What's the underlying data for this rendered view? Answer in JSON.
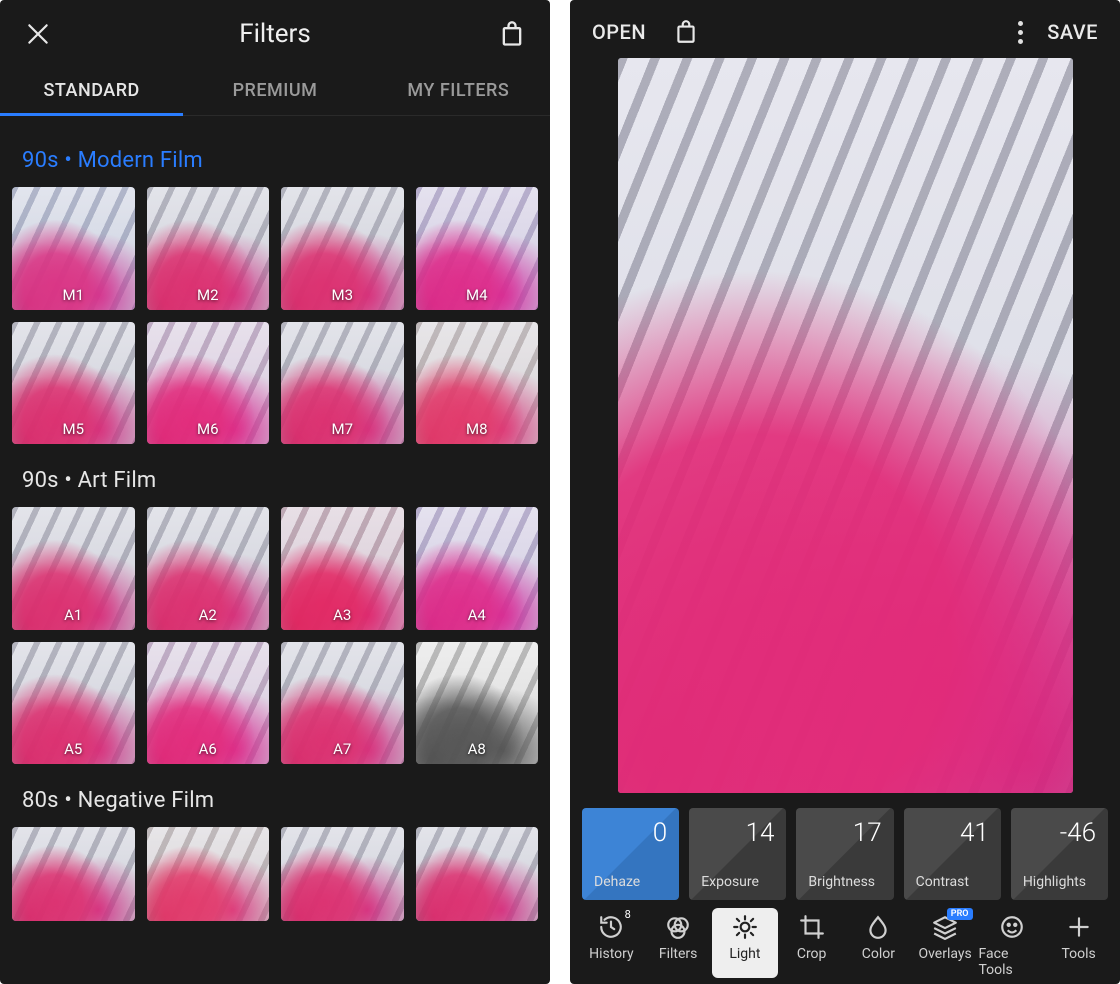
{
  "left": {
    "title": "Filters",
    "tabs": [
      {
        "label": "STANDARD",
        "active": true
      },
      {
        "label": "PREMIUM",
        "active": false
      },
      {
        "label": "MY FILTERS",
        "active": false
      }
    ],
    "sections": [
      {
        "title": "90s • Modern Film",
        "accent": true,
        "filters": [
          "M1",
          "M2",
          "M3",
          "M4",
          "M5",
          "M6",
          "M7",
          "M8"
        ],
        "tints": [
          "cool",
          "",
          "",
          "violet",
          "",
          "mag",
          "",
          "warm"
        ]
      },
      {
        "title": "90s • Art Film",
        "accent": false,
        "filters": [
          "A1",
          "A2",
          "A3",
          "A4",
          "A5",
          "A6",
          "A7",
          "A8"
        ],
        "tints": [
          "",
          "",
          "red",
          "violet",
          "",
          "mag",
          "",
          "bw"
        ]
      },
      {
        "title": "80s • Negative Film",
        "accent": false,
        "filters_partial": true,
        "filters": [
          "",
          "",
          "",
          ""
        ],
        "tints": [
          "",
          "warm",
          "",
          ""
        ]
      }
    ]
  },
  "right": {
    "open_label": "OPEN",
    "save_label": "SAVE",
    "sliders": [
      {
        "label": "Dehaze",
        "value": "0",
        "active": true
      },
      {
        "label": "Exposure",
        "value": "14",
        "active": false
      },
      {
        "label": "Brightness",
        "value": "17",
        "active": false
      },
      {
        "label": "Contrast",
        "value": "41",
        "active": false
      },
      {
        "label": "Highlights",
        "value": "-46",
        "active": false
      }
    ],
    "toolbar": [
      {
        "id": "history",
        "label": "History",
        "badge_count": "8"
      },
      {
        "id": "filters",
        "label": "Filters"
      },
      {
        "id": "light",
        "label": "Light",
        "active": true
      },
      {
        "id": "crop",
        "label": "Crop"
      },
      {
        "id": "color",
        "label": "Color"
      },
      {
        "id": "overlays",
        "label": "Overlays",
        "badge_pro": "PRO"
      },
      {
        "id": "face",
        "label": "Face Tools"
      },
      {
        "id": "tools",
        "label": "Tools"
      }
    ]
  }
}
